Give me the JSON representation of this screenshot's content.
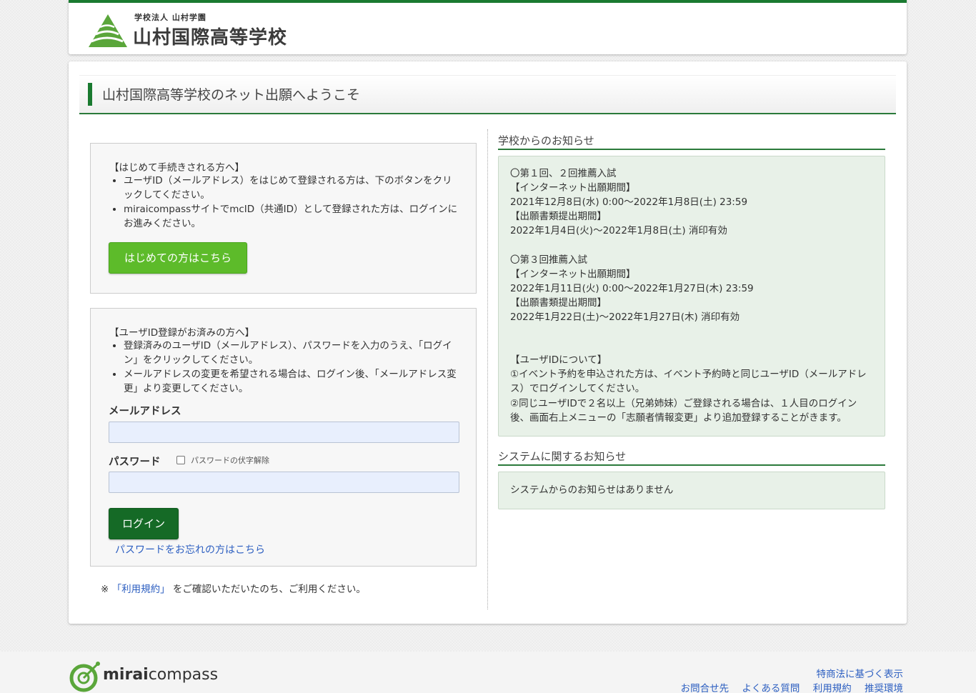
{
  "header": {
    "logo_sub": "学校法人 山村学園",
    "logo_main": "山村国際高等学校"
  },
  "welcome_title": "山村国際高等学校のネット出願へようこそ",
  "first_time": {
    "heading": "【はじめて手続きされる方へ】",
    "bullets": [
      "ユーザID（メールアドレス）をはじめて登録される方は、下のボタンをクリックしてください。",
      "miraicompassサイトでmcID（共通ID）として登録された方は、ログインにお進みください。"
    ],
    "button_label": "はじめての方はこちら"
  },
  "login": {
    "heading": "【ユーザID登録がお済みの方へ】",
    "bullets": [
      "登録済みのユーザID（メールアドレス）、パスワードを入力のうえ、「ログイン」をクリックしてください。",
      "メールアドレスの変更を希望される場合は、ログイン後、「メールアドレス変更」より変更してください。"
    ],
    "email_label": "メールアドレス",
    "email_value": "",
    "password_label": "パスワード",
    "unmask_label": "パスワードの伏字解除",
    "password_value": "",
    "login_button": "ログイン",
    "forgot_link": "パスワードをお忘れの方はこちら"
  },
  "terms_note": {
    "prefix": "※",
    "link": "「利用規約」",
    "suffix": "をご確認いただいたのち、ご利用ください。"
  },
  "school_notice": {
    "title": "学校からのお知らせ",
    "lines": [
      "〇第１回、２回推薦入試",
      "【インターネット出願期間】",
      "2021年12月8日(水) 0:00～2022年1月8日(土) 23:59",
      "【出願書類提出期間】",
      "2022年1月4日(火)～2022年1月8日(土) 消印有効",
      "",
      "〇第３回推薦入試",
      "【インターネット出願期間】",
      "2022年1月11日(火) 0:00～2022年1月27日(木) 23:59",
      "【出願書類提出期間】",
      "2022年1月22日(土)～2022年1月27日(木) 消印有効",
      "",
      "",
      "【ユーザIDについて】",
      "①イベント予約を申込された方は、イベント予約時と同じユーザID（メールアドレス）でログインしてください。",
      "②同じユーザIDで２名以上（兄弟姉妹）ご登録される場合は、１人目のログイン後、画面右上メニューの「志願者情報変更」より追加登録することがきます。"
    ]
  },
  "system_notice": {
    "title": "システムに関するお知らせ",
    "text": "システムからのお知らせはありません"
  },
  "footer": {
    "brand_bold": "mirai",
    "brand_rest": "compass",
    "links_top": [
      "特商法に基づく表示"
    ],
    "links_bottom": [
      "お問合せ先",
      "よくある質問",
      "利用規約",
      "推奨環境"
    ]
  },
  "colors": {
    "brand_green": "#1a7a30",
    "first_button": "#5dbb2a",
    "login_button": "#156a26",
    "link_blue": "#2d5fc1",
    "notice_bg": "#e8f1e8"
  }
}
